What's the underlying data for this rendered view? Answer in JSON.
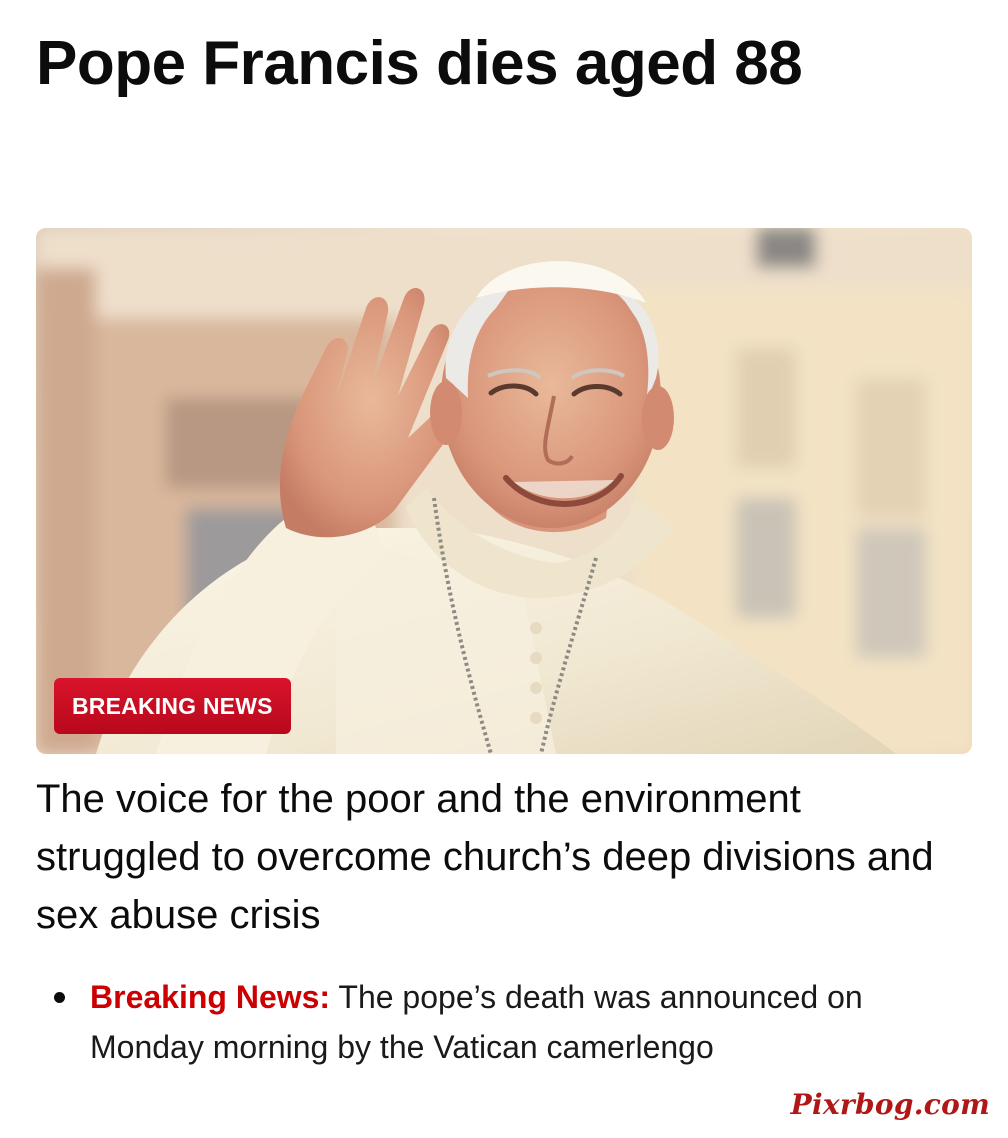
{
  "article": {
    "headline": "Pope Francis dies aged 88",
    "hero_badge": "BREAKING NEWS",
    "subheadline": "The voice for the poor and the environment struggled to overcome church’s deep divisions and sex abuse crisis",
    "bullets": [
      {
        "label": "Breaking News:",
        "text": " The pope’s death was announced on Monday morning by the Vatican camerlengo"
      }
    ]
  },
  "watermark": "Pixrbog.com",
  "colors": {
    "badge": "#c8102e",
    "bullet_label": "#cc0000",
    "watermark": "#b01818",
    "text": "#0c0c0c"
  }
}
